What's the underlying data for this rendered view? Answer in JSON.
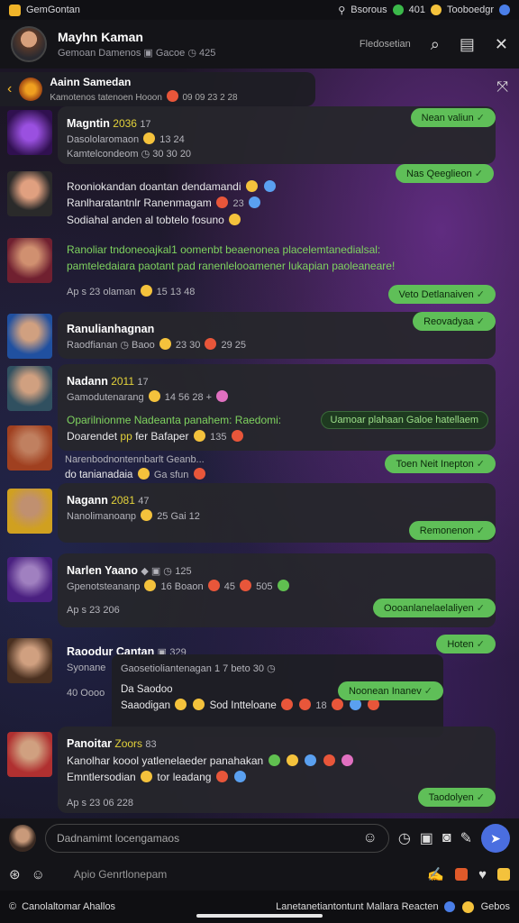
{
  "status_bar": {
    "app_name": "GemGontan",
    "right_a": "Bsorous",
    "right_b": "401",
    "right_c": "Tooboedgr"
  },
  "header": {
    "name": "Mayhn Kaman",
    "subtitle": "Gemoan Damenos",
    "sub_b": "Gacoe",
    "sub_c": "425",
    "action_label": "Fledosetian"
  },
  "pinned": {
    "title": "Aainn Samedan",
    "subtitle": "Kamotenos tatenoen",
    "sub_b": "Hooon",
    "sub_c": "09 09 23 2 28"
  },
  "messages": [
    {
      "name": "Magntin",
      "tag": "2036",
      "tag_b": "17",
      "line1": "Dasololaromaon",
      "line1_b": "13 24",
      "line2": "Kamtelcondeom",
      "line2_b": "30 30 20",
      "bubble_top": "Nean valiun",
      "bubble_bottom": "Nas Qeeglieon"
    },
    {
      "line1": "Rooniokandan doantan dendamandi",
      "line2": "Ranlharatantnlr Ranenmagam",
      "line2_b": "23",
      "line3": "Sodiahal anden al tobtelo fosuno"
    },
    {
      "green_line1": "Ranoliar tndoneoajkal1 oomenbt beaenonea placelemtanedialsal:",
      "green_line2": "pamteledaiara paotant pad ranenlelooamener lukapian paoleaneare!",
      "meta": "Ap s 23 olaman",
      "meta_b": "15 13 48",
      "bubble": "Veto Detlanaiven"
    },
    {
      "name": "Ranulianhagnan",
      "line1": "Raodfianan",
      "line1_b": "Baoo",
      "line1_c": "23 30",
      "line1_d": "29 25",
      "bubble": "Reovadyaa"
    },
    {
      "name": "Nadann",
      "tag": "2011",
      "tag_b": "17",
      "line1": "Gamodutenarang",
      "line1_b": "14 56 28 +",
      "green_line": "Oparilnionme Nadeanta panahem: Raedomi:",
      "dark_pill": "Uamoar plahaan Galoe hatellaem",
      "line2": "Doarendet",
      "line2_b": "pp",
      "line2_c": "fer Bafaper",
      "line2_d": "135",
      "line3": "Narenbodnontennbarlt Geanb...",
      "line4": "do tanianadaia",
      "line4_b": "Ga sfun",
      "bubble": "Toen Neit Inepton"
    },
    {
      "name": "Nagann",
      "tag": "2081",
      "tag_b": "47",
      "line1": "Nanolimanoanp",
      "line1_b": "25  Gai 12",
      "bubble": "Remonenon"
    },
    {
      "name": "Narlen Yaano",
      "name_b": "125",
      "line1": "Gpenotsteananp",
      "line1_b": "16 Boaon",
      "line1_c": "45",
      "line1_d": "505",
      "meta": "Ap s 23 206",
      "bubble": "Oooanlanelaelaliyen"
    },
    {
      "name": "Raoodur Cantan",
      "name_b": "329",
      "line1": "Syonane",
      "nested_line1": "Gaosetioliantenagan 1 7 beto 30",
      "meta": "40 Oooo",
      "nested_name": "Da Saodoo",
      "nested_line2": "Saaodigan",
      "nested_line2_b": "Sod Intteloane",
      "nested_line2_c": "18",
      "bubble_top": "Hoten",
      "bubble_mid": "Noonean Inanev"
    },
    {
      "name": "Panoitar",
      "tag": "Zoors",
      "tag_b": "83",
      "line1": "Kanolhar koool yatlenelaeder panahakan",
      "line2": "Emntlersodian",
      "line2_b": "tor leadang",
      "meta": "Ap s 23 06 228",
      "bubble": "Taodolyen"
    }
  ],
  "composer": {
    "placeholder": "Dadnamimt locengamaos"
  },
  "toolbar": {
    "text": "Apio Genrtlonepam"
  },
  "footer": {
    "left": "Canolaltomar Ahallos",
    "right": "Lanetanetiantontunt Mallara Reacten",
    "right_b": "Gebos"
  }
}
